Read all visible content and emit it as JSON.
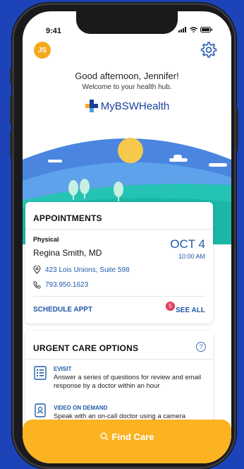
{
  "status": {
    "time": "9:41"
  },
  "header": {
    "avatar_initials": "JS",
    "greeting": "Good afternoon, Jennifer!",
    "subtitle": "Welcome to your health hub.",
    "logo_text": "MyBSWHealth"
  },
  "appointments": {
    "title": "APPOINTMENTS",
    "type": "Physical",
    "doctor": "Regina Smith, MD",
    "date": "OCT 4",
    "time": "10:00 AM",
    "address": "423 Lois Unions, Suite 598",
    "phone": "793.950.1623",
    "schedule_label": "SCHEDULE APPT",
    "see_all_label": "SEE ALL",
    "badge_count": "5"
  },
  "urgent": {
    "title": "URGENT CARE OPTIONS",
    "help_label": "?",
    "options": [
      {
        "title": "EVISIT",
        "desc": "Answer a series of questions for review and email response by a doctor within an hour"
      },
      {
        "title": "VIDEO ON DEMAND",
        "desc": "Speak with an on-call doctor using a camera"
      }
    ]
  },
  "footer": {
    "find_care_label": "Find Care"
  },
  "colors": {
    "brand_blue": "#1f5aa8",
    "accent_orange": "#fbb321",
    "background": "#1c44b8",
    "badge_red": "#e0405a"
  }
}
